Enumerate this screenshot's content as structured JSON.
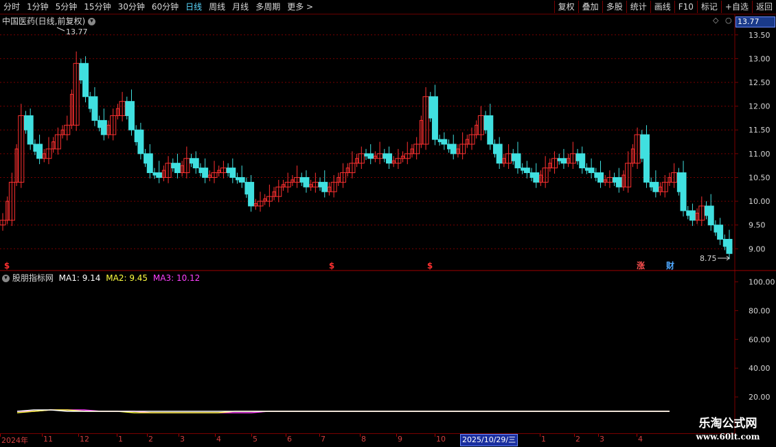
{
  "toolbar": {
    "periods": [
      "分时",
      "1分钟",
      "5分钟",
      "15分钟",
      "30分钟",
      "60分钟",
      "日线",
      "周线",
      "月线",
      "多周期",
      "更多 >"
    ],
    "active_period": "日线",
    "actions": [
      "复权",
      "叠加",
      "多股",
      "统计",
      "画线",
      "F10",
      "标记",
      "+自选",
      "返回"
    ]
  },
  "main_chart": {
    "title": "中国医药(日线,前复权)",
    "current_price": "13.77",
    "high_label": "13.77",
    "low_label": "8.75",
    "y_ticks": [
      "13.50",
      "13.00",
      "12.50",
      "12.00",
      "11.50",
      "11.00",
      "10.50",
      "10.00",
      "9.50",
      "9.00"
    ],
    "event_markers": [
      {
        "text": "$",
        "color": "#ff3030"
      },
      {
        "text": "$",
        "color": "#ff3030"
      },
      {
        "text": "$",
        "color": "#ff3030"
      },
      {
        "text": "涨",
        "color": "#ff5050"
      },
      {
        "text": "财",
        "color": "#4fa8ff"
      }
    ]
  },
  "indicator": {
    "name": "股朋指标网",
    "ma1_label": "MA1: 9.14",
    "ma2_label": "MA2: 9.45",
    "ma3_label": "MA3: 10.12",
    "ma1_color": "#ffffff",
    "ma2_color": "#ffff40",
    "ma3_color": "#ff40ff",
    "y_ticks": [
      "100.00",
      "80.00",
      "60.00",
      "40.00",
      "20.00"
    ]
  },
  "date_axis": {
    "labels": [
      "2024年",
      "11",
      "12",
      "1",
      "2",
      "3",
      "4",
      "5",
      "6",
      "7",
      "8",
      "9",
      "10",
      "1",
      "2",
      "3",
      "4"
    ],
    "cursor_date": "2025/10/29/三"
  },
  "watermark": {
    "line1": "乐淘公式网",
    "line2": "www.60lt.com"
  },
  "colors": {
    "up": "#ff3030",
    "down": "#40e0e0",
    "grid": "#7a0000"
  },
  "chart_data": {
    "type": "candlestick",
    "y_range": [
      8.6,
      13.8
    ],
    "close_series": [
      9.6,
      10.4,
      11.8,
      11.2,
      10.9,
      11.1,
      11.4,
      11.6,
      12.9,
      12.2,
      11.7,
      11.4,
      11.8,
      12.1,
      11.5,
      11.0,
      10.6,
      10.5,
      10.8,
      10.6,
      10.9,
      10.7,
      10.5,
      10.6,
      10.7,
      10.5,
      10.4,
      9.9,
      10.0,
      10.1,
      10.3,
      10.4,
      10.5,
      10.3,
      10.4,
      10.2,
      10.4,
      10.6,
      10.8,
      11.0,
      10.9,
      11.0,
      10.8,
      10.9,
      11.0,
      11.2,
      12.2,
      11.3,
      11.2,
      11.0,
      11.2,
      11.4,
      11.8,
      11.2,
      10.8,
      11.0,
      10.7,
      10.6,
      10.4,
      10.7,
      10.9,
      10.8,
      11.0,
      10.7,
      10.6,
      10.4,
      10.5,
      10.3,
      10.8,
      11.4,
      10.4,
      10.2,
      10.4,
      10.6,
      9.8,
      9.6,
      9.9,
      9.5,
      9.2,
      8.9
    ],
    "ma1_series": [
      10,
      11,
      11,
      10,
      10,
      10,
      10,
      10,
      10,
      10,
      10,
      10,
      10,
      10,
      10,
      10,
      10,
      10,
      10,
      10,
      10,
      10,
      10,
      10,
      10,
      10,
      10,
      10,
      10,
      10,
      10,
      10,
      10,
      10,
      10,
      10,
      10,
      10,
      10,
      10
    ],
    "ma2_series": [
      9,
      10,
      11,
      11,
      10,
      10,
      10,
      9,
      9,
      9,
      9,
      9,
      9,
      10,
      10,
      10,
      10,
      10,
      10,
      10,
      10,
      10,
      10,
      10,
      10,
      10,
      10,
      10,
      10,
      10,
      10,
      10,
      10,
      10,
      10,
      10,
      10,
      10,
      10,
      10
    ],
    "ma3_series": [
      10,
      10,
      11,
      11,
      11,
      10,
      10,
      10,
      9,
      9,
      9,
      9,
      9,
      9,
      9,
      10,
      10,
      10,
      10,
      10,
      10,
      10,
      10,
      10,
      10,
      10,
      10,
      10,
      10,
      10,
      10,
      10,
      10,
      10,
      10,
      10,
      10,
      10,
      10,
      10
    ]
  }
}
